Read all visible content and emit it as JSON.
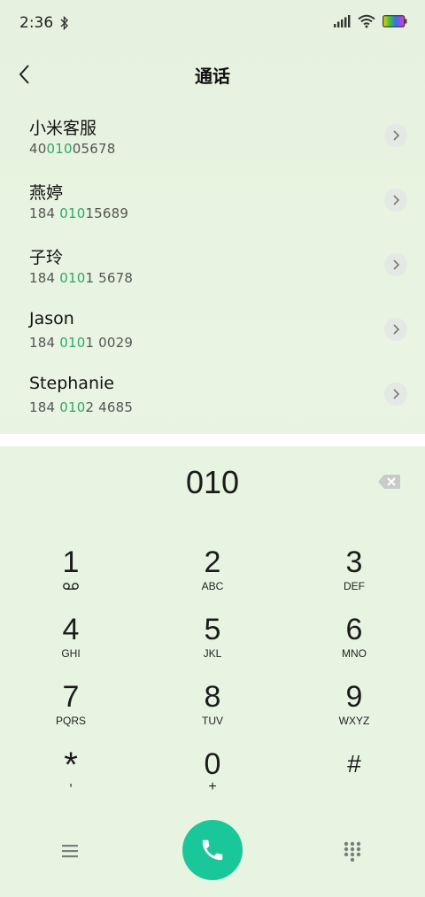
{
  "status_bar": {
    "time": "2:36",
    "icons": [
      "bluetooth-icon",
      "signal-icon",
      "wifi-icon",
      "battery-icon"
    ]
  },
  "header": {
    "title": "通话",
    "back_icon": "chevron-left-icon"
  },
  "results": [
    {
      "name": "小米客服",
      "number_prefix": "40",
      "number_match": "010",
      "number_suffix": "05678"
    },
    {
      "name": "燕婷",
      "number_prefix": "184 ",
      "number_match": "010",
      "number_suffix": "15689"
    },
    {
      "name": "子玲",
      "number_prefix": "184 ",
      "number_match": "010",
      "number_suffix": "1 5678"
    },
    {
      "name": "Jason",
      "number_prefix": "184 ",
      "number_match": "010",
      "number_suffix": "1 0029"
    },
    {
      "name": "Stephanie",
      "number_prefix": "184 ",
      "number_match": "010",
      "number_suffix": "2 4685"
    }
  ],
  "dialer": {
    "display": "010",
    "keys": [
      {
        "digit": "1",
        "letters": ""
      },
      {
        "digit": "2",
        "letters": "ABC"
      },
      {
        "digit": "3",
        "letters": "DEF"
      },
      {
        "digit": "4",
        "letters": "GHI"
      },
      {
        "digit": "5",
        "letters": "JKL"
      },
      {
        "digit": "6",
        "letters": "MNO"
      },
      {
        "digit": "7",
        "letters": "PQRS"
      },
      {
        "digit": "8",
        "letters": "TUV"
      },
      {
        "digit": "9",
        "letters": "WXYZ"
      },
      {
        "digit": "*",
        "letters": ","
      },
      {
        "digit": "0",
        "letters": "+"
      },
      {
        "digit": "#",
        "letters": ""
      }
    ]
  },
  "colors": {
    "accent": "#2ea86a",
    "call_button": "#19c79a",
    "background": "#e8f4e2"
  }
}
